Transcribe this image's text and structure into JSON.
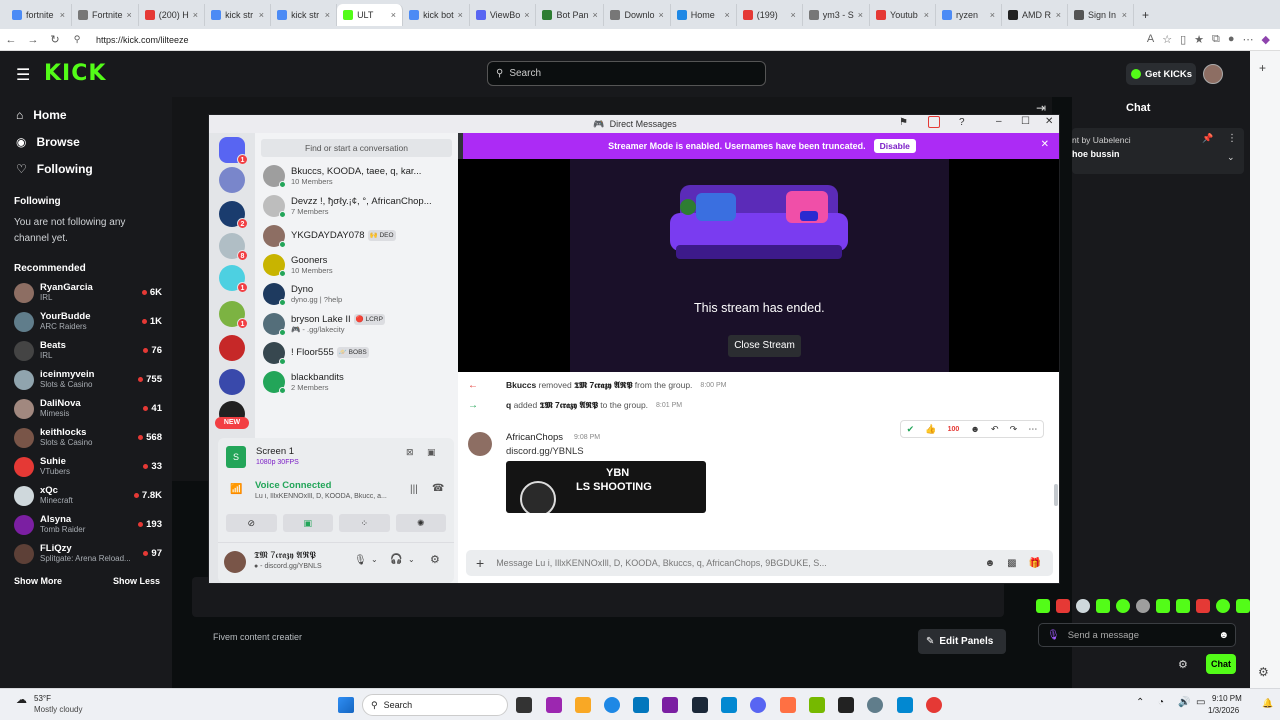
{
  "browser": {
    "tabs": [
      {
        "label": "fortnite",
        "color": "#4c8bf5"
      },
      {
        "label": "Fortnite",
        "color": "#777777"
      },
      {
        "label": "(200) H",
        "color": "#e53935"
      },
      {
        "label": "kick str",
        "color": "#4c8bf5"
      },
      {
        "label": "kick str",
        "color": "#4c8bf5"
      },
      {
        "label": "ULT",
        "color": "#53fc18",
        "active": true
      },
      {
        "label": "kick bot",
        "color": "#4c8bf5"
      },
      {
        "label": "ViewBo",
        "color": "#5865f2"
      },
      {
        "label": "Bot Pan",
        "color": "#2e7d32"
      },
      {
        "label": "Downlo",
        "color": "#777777"
      },
      {
        "label": "Home",
        "color": "#1e88e5"
      },
      {
        "label": "(199)",
        "color": "#e53935"
      },
      {
        "label": "ym3 - S",
        "color": "#777777"
      },
      {
        "label": "Youtub",
        "color": "#e53935"
      },
      {
        "label": "ryzen",
        "color": "#4c8bf5"
      },
      {
        "label": "AMD R",
        "color": "#222222"
      },
      {
        "label": "Sign In",
        "color": "#555555"
      }
    ],
    "url": "https://kick.com/lilteeze"
  },
  "kick": {
    "logo": "KICK",
    "search_placeholder": "Search",
    "get_kicks": "Get KICKs",
    "nav": [
      {
        "label": "Home",
        "icon": "home-icon",
        "glyph": "⌂"
      },
      {
        "label": "Browse",
        "icon": "compass-icon",
        "glyph": "◉"
      },
      {
        "label": "Following",
        "icon": "heart-icon",
        "glyph": "♡"
      }
    ],
    "following_title": "Following",
    "following_empty": "You are not following any channel yet.",
    "recommended_title": "Recommended",
    "recommended": [
      {
        "name": "RyanGarcia",
        "category": "IRL",
        "viewers": "6K",
        "color": "#8d6e63"
      },
      {
        "name": "YourBudde",
        "category": "ARC Raiders",
        "viewers": "1K",
        "color": "#607d8b"
      },
      {
        "name": "Beats",
        "category": "IRL",
        "viewers": "76",
        "color": "#444444"
      },
      {
        "name": "iceinmyvein",
        "category": "Slots & Casino",
        "viewers": "755",
        "color": "#90a4ae"
      },
      {
        "name": "DaliNova",
        "category": "Mimesis",
        "viewers": "41",
        "color": "#a1887f"
      },
      {
        "name": "keithlocks",
        "category": "Slots & Casino",
        "viewers": "568",
        "color": "#795548"
      },
      {
        "name": "Suhie",
        "category": "VTubers",
        "viewers": "33",
        "color": "#e53935"
      },
      {
        "name": "xQc",
        "category": "Minecraft",
        "viewers": "7.8K",
        "color": "#cfd8dc"
      },
      {
        "name": "Alsyna",
        "category": "Tomb Raider",
        "viewers": "193",
        "color": "#7b1fa2"
      },
      {
        "name": "FLiQzy",
        "category": "Splitgate: Arena Reload...",
        "viewers": "97",
        "color": "#5d4037"
      }
    ],
    "show_more": "Show More",
    "show_less": "Show Less",
    "chat_title": "Chat",
    "pinned_by": "nt by Uabelenci",
    "pinned_text": "hoe bussin",
    "content_creator": "Fivem content creatier",
    "edit_panels": "Edit Panels",
    "send_placeholder": "Send a message",
    "chat_button": "Chat",
    "brand_color": "#53fc18"
  },
  "discord": {
    "window_title": "Direct Messages",
    "streamer_mode_text": "Streamer Mode is enabled. Usernames have been truncated.",
    "disable_label": "Disable",
    "find_conversation": "Find or start a conversation",
    "dms": [
      {
        "name": "Bkuccs, KOODA, taee, q, kar...",
        "sub": "10 Members",
        "color": "#9e9e9e"
      },
      {
        "name": "Devzz !, ђσℓу.¡¢, °, AfricanChop...",
        "sub": "7 Members",
        "color": "#bdbdbd"
      },
      {
        "name": "YKGDAYDAY078",
        "tag": "🙌 DEO",
        "sub": "",
        "color": "#8d6e63"
      },
      {
        "name": "Gooners",
        "sub": "10 Members",
        "color": "#c8b400"
      },
      {
        "name": "Dyno",
        "sub": "dyno.gg | ?help",
        "color": "#1e3a5f"
      },
      {
        "name": "bryson Lake II",
        "tag": "🔴 LCRP",
        "sub": "🎮 - .gg/lakecity",
        "color": "#546e7a"
      },
      {
        "name": "!   Floor555",
        "tag": "🪐 BOBS",
        "sub": "",
        "color": "#37474f"
      },
      {
        "name": "blackbandits",
        "sub": "2 Members",
        "color": "#23a559"
      }
    ],
    "new_badge": "NEW",
    "screen_share": {
      "title": "Screen 1",
      "quality": "1080p 30FPS"
    },
    "voice": {
      "status": "Voice Connected",
      "members": "Lu i, IllxKENNOxIll, D, KOODA, Bkucc, a..."
    },
    "user": {
      "name": "𝕿𝕸 7𝖈𝖗𝖆𝖟𝖞 𝕬𝕽𝕻",
      "status": "● - discord.gg/YBNLS"
    },
    "stream_ended": "This stream has ended.",
    "close_stream": "Close Stream",
    "system_messages": [
      {
        "actor": "Bkuccs",
        "action": "removed",
        "target": "𝕿𝕸 7𝖈𝖗𝖆𝖟𝖞 𝕬𝕽𝕻",
        "suffix": "from the group.",
        "time": "8:00 PM"
      },
      {
        "actor": "q",
        "action": "added",
        "target": "𝕿𝕸 7𝖈𝖗𝖆𝖟𝖞 𝕬𝕽𝕻",
        "suffix": "to the group.",
        "time": "8:01 PM"
      }
    ],
    "message": {
      "author": "AfricanChops",
      "time": "9:08 PM",
      "text": "discord.gg/YBNLS",
      "embed_title": "YBN",
      "embed_subtitle": "LS SHOOTING"
    },
    "message_placeholder": "Message Lu i, IllxKENNOxIll, D, KOODA, Bkuccs, q, AfricanChops, 9BGDUKE, S...",
    "accent": "#ac2bf5"
  },
  "taskbar": {
    "weather_temp": "53°F",
    "weather_desc": "Mostly cloudy",
    "search_label": "Search",
    "time": "9:10 PM",
    "date": "1/3/2026"
  }
}
